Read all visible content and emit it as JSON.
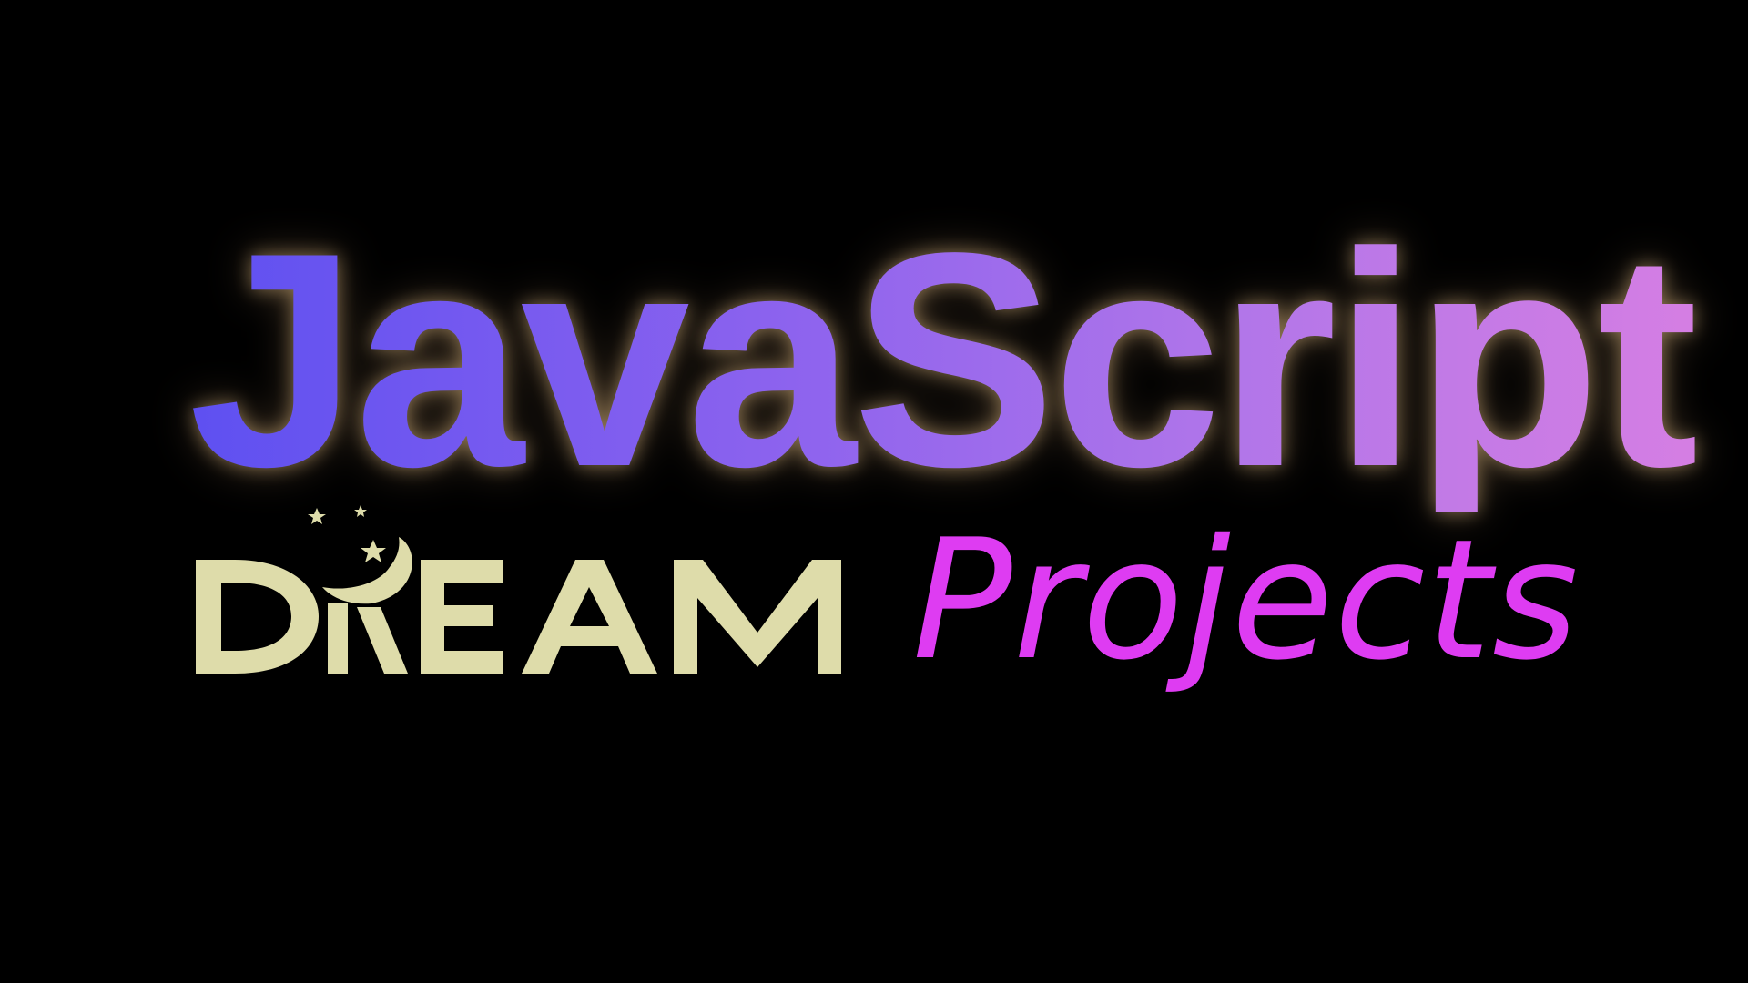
{
  "banner": {
    "title": "JavaScript",
    "logo_text": "DREAM",
    "subtitle": "Projects"
  },
  "colors": {
    "background": "#000000",
    "title_gradient_start": "#5e50f1",
    "title_gradient_end": "#d57ee3",
    "title_glow": "#ffd796",
    "logo": "#dedcaa",
    "subtitle": "#de3cf2"
  },
  "icons": {
    "logo_moon": "crescent-moon-icon",
    "logo_stars": "star-icon"
  }
}
